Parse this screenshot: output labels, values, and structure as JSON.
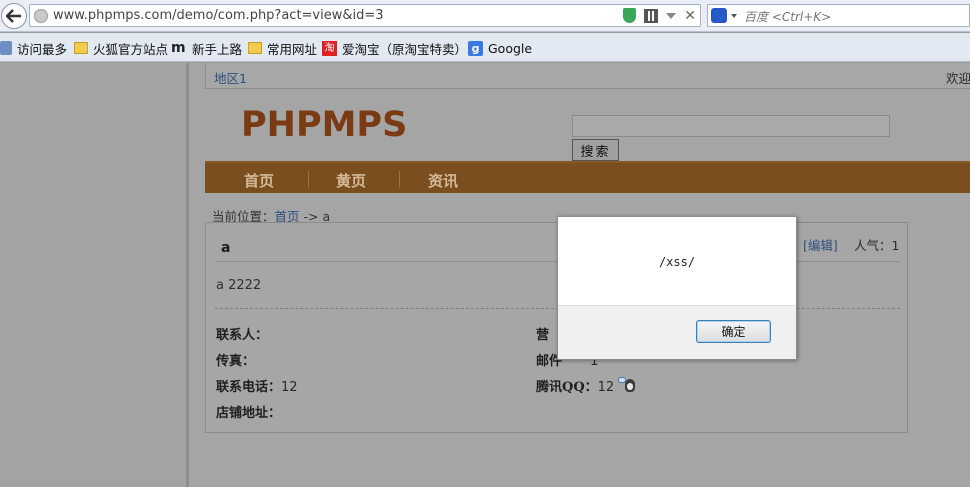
{
  "browser": {
    "url": "www.phpmps.com/demo/com.php?act=view&id=3",
    "search_placeholder": "百度 <Ctrl+K>",
    "bookmarks": [
      {
        "label": "访问最多",
        "icon": "most-visited-icon"
      },
      {
        "label": "火狐官方站点",
        "icon": "folder-icon"
      },
      {
        "label": "新手上路",
        "icon": "m-logo-icon"
      },
      {
        "label": "常用网址",
        "icon": "folder-icon"
      },
      {
        "label": "爱淘宝（原淘宝特卖）",
        "icon": "taobao-icon"
      },
      {
        "label": "Google",
        "icon": "google-icon"
      }
    ]
  },
  "page": {
    "topbar": {
      "region": "地区1",
      "welcome": "欢迎"
    },
    "logo": "PHPMPS",
    "search_button": "搜索",
    "nav": [
      {
        "label": "首页"
      },
      {
        "label": "黄页"
      },
      {
        "label": "资讯"
      }
    ],
    "breadcrumb": {
      "prefix": "当前位置：",
      "home": "首页",
      "sep": " -> ",
      "current": "a"
    },
    "detail": {
      "title": "a",
      "edit": "[编辑]",
      "popularity": "人气：1",
      "body": "a  2222",
      "fields": {
        "contact": {
          "label": "联系人：",
          "value": ""
        },
        "fax": {
          "label": "传真：",
          "value": ""
        },
        "phone": {
          "label": "联系电话：",
          "value": "12"
        },
        "address": {
          "label": "店铺地址：",
          "value": ""
        },
        "business_partial": {
          "label": "营"
        },
        "email_partial": {
          "label": "邮件",
          "value": "1"
        },
        "qq": {
          "label": "腾讯QQ：",
          "value": "12"
        }
      }
    }
  },
  "dialog": {
    "message": "/xss/",
    "ok_label": "确定"
  },
  "colors": {
    "nav_bar": "#7a4e1e",
    "logo": "#7a3a12",
    "link": "#2f4f7f",
    "dialog_button_border": "#3c7fb1"
  }
}
